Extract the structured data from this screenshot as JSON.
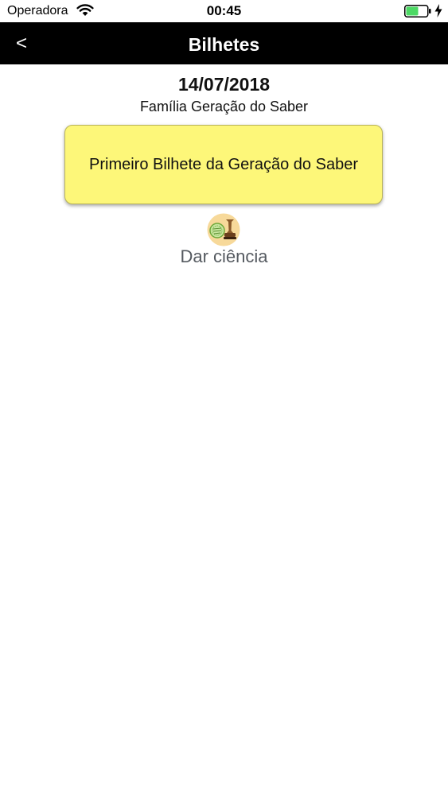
{
  "status_bar": {
    "carrier": "Operadora",
    "time": "00:45",
    "icons": [
      "wifi-icon",
      "battery-charging-icon"
    ]
  },
  "nav": {
    "back_label": "<",
    "title": "Bilhetes"
  },
  "note": {
    "date": "14/07/2018",
    "sender": "Família Geração do Saber",
    "message": "Primeiro Bilhete da Geração do Saber",
    "card_color": "#fdf779"
  },
  "acknowledge": {
    "icon": "stamp-icon",
    "label": "Dar ciência"
  }
}
